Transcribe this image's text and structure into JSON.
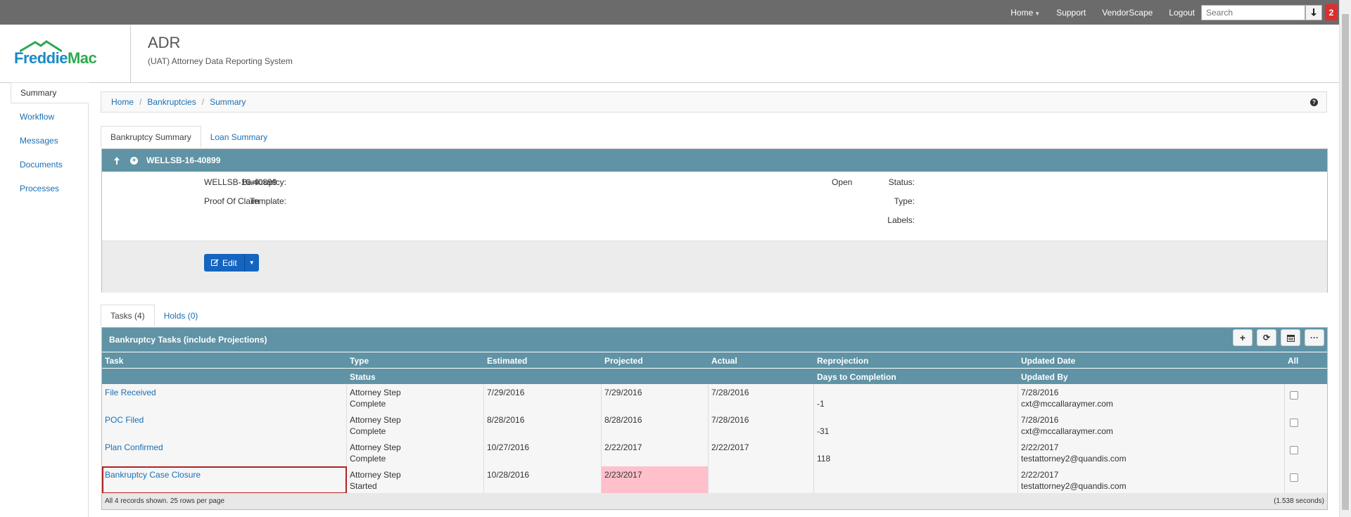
{
  "topnav": {
    "home_label": "Home",
    "support_label": "Support",
    "vendorscape_label": "VendorScape",
    "logout_label": "Logout",
    "search_placeholder": "Search",
    "notification_count": "2"
  },
  "header": {
    "logo_text_freddie": "Freddie",
    "logo_text_mac": "Mac",
    "app_title": "ADR",
    "app_subtitle": "(UAT) Attorney Data Reporting System"
  },
  "sidebar": {
    "items": [
      {
        "label": "Summary"
      },
      {
        "label": "Workflow"
      },
      {
        "label": "Messages"
      },
      {
        "label": "Documents"
      },
      {
        "label": "Processes"
      }
    ]
  },
  "breadcrumb": [
    "Home",
    "Bankruptcies",
    "Summary"
  ],
  "summary_tabs": [
    "Bankruptcy Summary",
    "Loan Summary"
  ],
  "bankruptcy": {
    "number": "WELLSB-16-40899",
    "bankruptcy_label": "Bankruptcy:",
    "bankruptcy_value": "WELLSB-16-40899",
    "template_label": "Template:",
    "template_value": "Proof Of Claim",
    "status_label": "Status:",
    "status_value": "Open",
    "type_label": "Type:",
    "labels_label": "Labels:",
    "edit_label": "Edit"
  },
  "task_tabs": [
    "Tasks (4)",
    "Holds (0)"
  ],
  "tasks": {
    "title": "Bankruptcy Tasks (include Projections)",
    "headers": {
      "task": "Task",
      "type": "Type",
      "estimated": "Estimated",
      "projected": "Projected",
      "actual": "Actual",
      "reprojection": "Reprojection",
      "updated_date": "Updated Date",
      "all": "All",
      "status": "Status",
      "days_to_completion": "Days to Completion",
      "updated_by": "Updated By"
    },
    "rows": [
      {
        "task": "File Received",
        "type": "Attorney Step",
        "status": "Complete",
        "estimated": "7/29/2016",
        "projected": "7/29/2016",
        "actual": "7/28/2016",
        "days": "-1",
        "updated_date": "7/28/2016",
        "updated_by": "cxt@mccallaraymer.com"
      },
      {
        "task": "POC Filed",
        "type": "Attorney Step",
        "status": "Complete",
        "estimated": "8/28/2016",
        "projected": "8/28/2016",
        "actual": "7/28/2016",
        "days": "-31",
        "updated_date": "7/28/2016",
        "updated_by": "cxt@mccallaraymer.com"
      },
      {
        "task": "Plan Confirmed",
        "type": "Attorney Step",
        "status": "Complete",
        "estimated": "10/27/2016",
        "projected": "2/22/2017",
        "actual": "2/22/2017",
        "days": "118",
        "updated_date": "2/22/2017",
        "updated_by": "testattorney2@quandis.com"
      },
      {
        "task": "Bankruptcy Case Closure",
        "type": "Attorney Step",
        "status": "Started",
        "estimated": "10/28/2016",
        "projected": "2/23/2017",
        "actual": "",
        "days": "",
        "updated_date": "2/22/2017",
        "updated_by": "testattorney2@quandis.com"
      }
    ],
    "footer_left": "All 4 records shown. 25 rows per page",
    "footer_right": "(1.538 seconds)"
  },
  "colors": {
    "panel_header": "#5f93a5",
    "link": "#1a6fb3",
    "highlight_projected": "#ffc0cb",
    "edit_button": "#1565c0",
    "notification": "#d9302f"
  }
}
